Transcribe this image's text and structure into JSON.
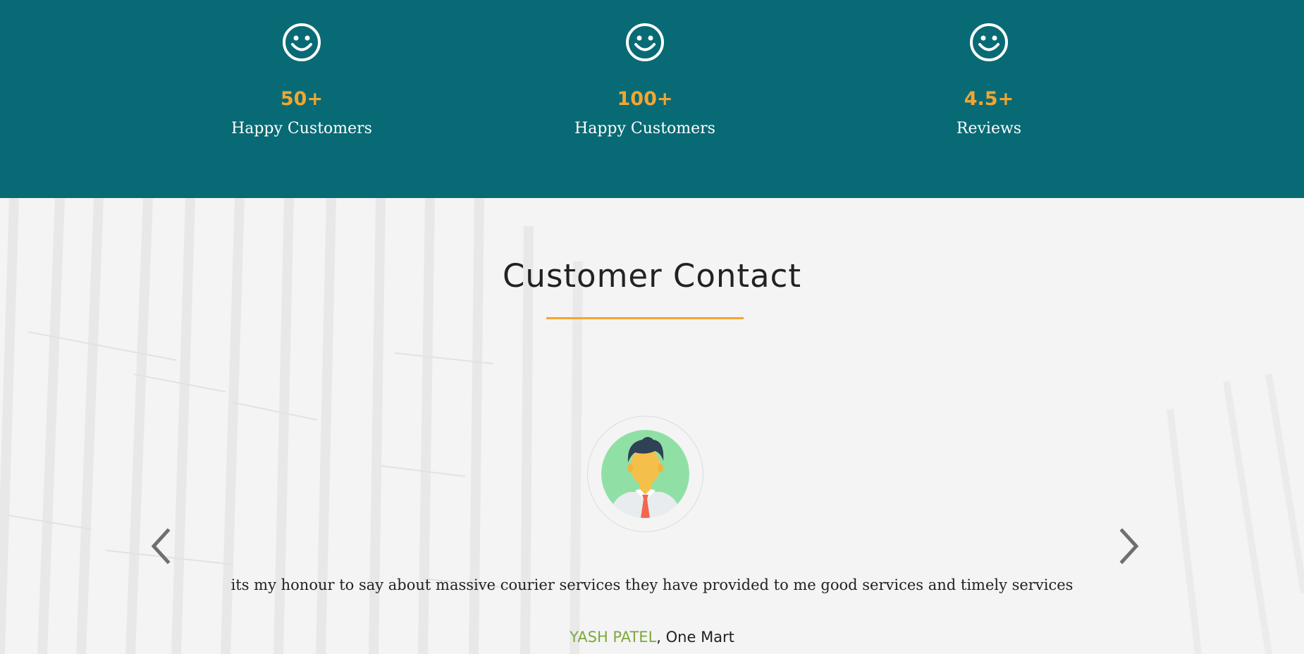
{
  "stats": [
    {
      "icon": "smiley-icon",
      "value": "50+",
      "label": "Happy Customers"
    },
    {
      "icon": "smiley-icon",
      "value": "100+",
      "label": "Happy Customers"
    },
    {
      "icon": "smiley-icon",
      "value": "4.5+",
      "label": "Reviews"
    }
  ],
  "testimonials": {
    "title": "Customer Contact",
    "quote": "its my honour to say about massive courier services they have provided to me good services and timely services",
    "author_name": "YASH PATEL",
    "author_company": ", One Mart",
    "prev_icon": "chevron-left-icon",
    "next_icon": "chevron-right-icon",
    "avatar_icon": "user-avatar-icon"
  },
  "colors": {
    "stats_background": "#086a74",
    "accent": "#f2a630",
    "author_name": "#7ea83c",
    "section_background": "#f4f4f4"
  }
}
